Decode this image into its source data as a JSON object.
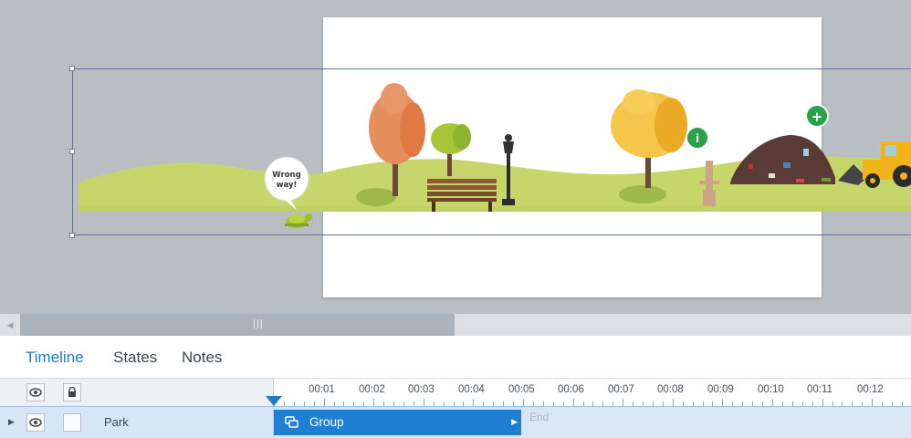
{
  "stage": {
    "speech_bubble": [
      "Wrong",
      "way!"
    ],
    "info_hotspot": "i",
    "add_hotspot": "+"
  },
  "timeline": {
    "tabs": [
      {
        "label": "Timeline",
        "active": true
      },
      {
        "label": "States",
        "active": false
      },
      {
        "label": "Notes",
        "active": false
      }
    ],
    "ruler_labels": [
      "00:01",
      "00:02",
      "00:03",
      "00:04",
      "00:05",
      "00:06",
      "00:07",
      "00:08",
      "00:09",
      "00:10",
      "00:11",
      "00:12"
    ],
    "layer": {
      "name": "Park",
      "group_label": "Group",
      "end_label": "End"
    },
    "icons": {
      "visibility": "eye-icon",
      "lock": "lock-icon",
      "expand": "triangle-right-icon",
      "group": "group-icon",
      "scroll_left": "arrow-left-icon",
      "scroll_grip": "grip-icon"
    }
  },
  "colors": {
    "accent": "#1e7cc7",
    "group_bar": "#1f7fd0",
    "hill": "#c7d66a",
    "hotspot": "#27a24a"
  }
}
